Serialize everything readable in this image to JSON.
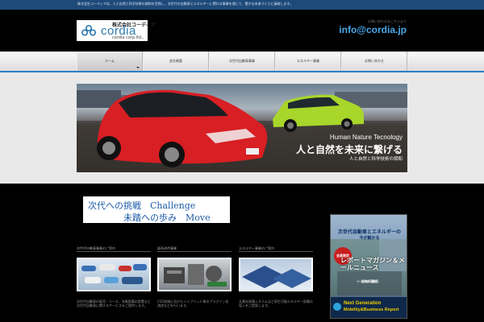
{
  "topbar": {
    "tagline": "株式会社コーディアは、人と自然と科学技術の調和を目指し、次世代の自動車とエネルギーに関わる事業を通じて、豊かな未来づくりに貢献します。"
  },
  "header": {
    "logo": {
      "company_jp": "株式会社コーディア",
      "brand": "cordia",
      "corp": "cordia corp.ltd.,"
    },
    "contact_note": "お問い合わせはこちらまで",
    "email": "info@cordia.jp"
  },
  "nav": {
    "items": [
      {
        "label": "ホーム"
      },
      {
        "label": "会社概要"
      },
      {
        "label": "次世代自動車事業"
      },
      {
        "label": "エネルギー事業"
      },
      {
        "label": "お問い合わせ"
      }
    ]
  },
  "hero": {
    "subtitle_en": "Human Nature Tecnology",
    "headline": "人と自然を未来に繋げる",
    "subtitle_jp": "人と自然と科学技術の調和"
  },
  "challenge": {
    "line1": "次代への挑戦　Challenge",
    "line2": "未踏への歩み　Move"
  },
  "features": [
    {
      "title": "次世代自動車事業のご案内",
      "desc": "次世代自動車の販売・リース、充電設備の設置など次世代自動車に関するサービスをご提供します。"
    },
    {
      "title": "車両改造事業",
      "desc": "CO2削減に向けたハイブリッド車のプラグイン化改造などを行います。"
    },
    {
      "title": "エネルギー事業のご案内",
      "desc": "太陽光発電システムなど再生可能エネルギー設備の導入をご提案します。"
    }
  ],
  "ad": {
    "t1": "次世代自動車とエネルギーの",
    "t2": "今が解かる",
    "badge": "会員限定",
    "t3": "レポートマガジン＆メールニュース",
    "t4": "（一部無料購読）",
    "e1": "Next Generation",
    "e2": "Mobility&Business Report"
  },
  "colors": {
    "accent": "#2e7ec2",
    "email": "#4aa7e8",
    "hero_text": "#ffffff",
    "car_red": "#d81f24",
    "car_green": "#a8d62a"
  }
}
